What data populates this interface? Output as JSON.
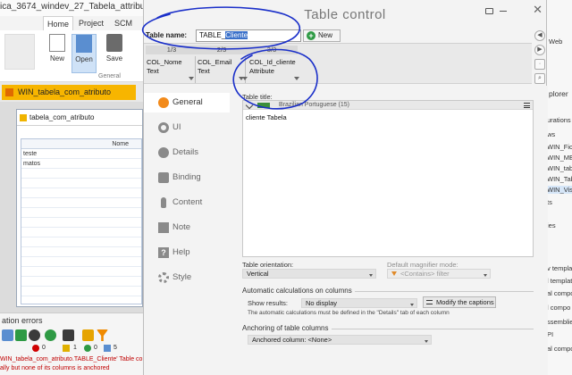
{
  "ide": {
    "title": "ica_3674_windev_27_Tabela_attribute -",
    "tabs": [
      "Home",
      "Project",
      "SCM"
    ],
    "ribbon": {
      "new": "New",
      "open": "Open",
      "save": "Save",
      "group": "General"
    },
    "doc_tab": "WIN_tabela_com_atributo",
    "window_title": "tabela_com_atributo",
    "grid": {
      "header": "Nome",
      "rows": [
        "teste",
        "matos"
      ]
    },
    "errors": {
      "title": "ation errors",
      "counts": [
        "0",
        "1",
        "0",
        "5"
      ],
      "line1": "WIN_tabela_com_atributo.TABLE_Cliente' Table con",
      "line2": "ally but none of its columns is anchored"
    },
    "right_panel": {
      "web": "Web",
      "explorer": "plorer",
      "items": [
        "urations",
        "ws",
        "WIN_Fich",
        "WIN_MEN",
        "WIN_tabe",
        "WIN_Tab",
        "WIN_Visi",
        "ts",
        "ies",
        "v templat",
        "l templat",
        "al compo",
        "l compo",
        "ssemblie",
        "PI",
        "al compo"
      ]
    }
  },
  "dialog": {
    "title": "Table control",
    "table_name_label": "Table name:",
    "table_name_prefix": "TABLE_",
    "table_name_selected": "Cliente",
    "new_button": "New",
    "columns": [
      {
        "index": "1/3",
        "name": "COL_Nome",
        "type": "Text"
      },
      {
        "index": "2/3",
        "name": "COL_Email",
        "type": "Text"
      },
      {
        "index": "3/3",
        "name": "COL_Id_cliente",
        "type": "Attribute"
      }
    ],
    "nav": [
      {
        "id": "general",
        "label": "General",
        "icon": "general-icon"
      },
      {
        "id": "ui",
        "label": "UI",
        "icon": "ui-icon"
      },
      {
        "id": "details",
        "label": "Details",
        "icon": "details-icon"
      },
      {
        "id": "binding",
        "label": "Binding",
        "icon": "binding-icon"
      },
      {
        "id": "content",
        "label": "Content",
        "icon": "content-icon"
      },
      {
        "id": "note",
        "label": "Note",
        "icon": "note-icon"
      },
      {
        "id": "help",
        "label": "Help",
        "icon": "help-icon"
      },
      {
        "id": "style",
        "label": "Style",
        "icon": "style-icon"
      }
    ],
    "active_nav": "General",
    "general": {
      "table_title_label": "Table title:",
      "language": "Brazilian Portuguese (15)",
      "table_title_value": "cliente Tabela",
      "orientation_label": "Table orientation:",
      "orientation_value": "Vertical",
      "magnifier_label": "Default magnifier mode:",
      "magnifier_value": "<Contains> filter",
      "auto_calc_group": "Automatic calculations on columns",
      "show_results_label": "Show results:",
      "show_results_value": "No display",
      "modify_captions_button": "Modify the captions",
      "auto_calc_note": "The automatic calculations must be defined in the \"Details\" tab of each column",
      "anchoring_group": "Anchoring of table columns",
      "anchored_column_value": "Anchored column: <None>"
    }
  },
  "colors": {
    "accent_orange": "#f7b500",
    "annotation_blue": "#1a2fc9",
    "selection_blue": "#3a70c9",
    "error_red": "#c00000",
    "new_green": "#2e9a44"
  }
}
